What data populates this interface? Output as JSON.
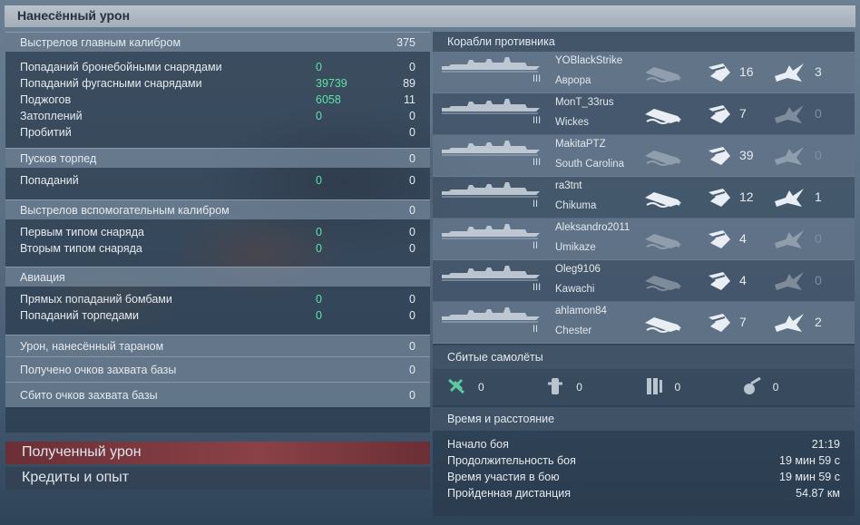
{
  "title": "Нанесённый урон",
  "main_caliber": {
    "label": "Выстрелов главным калибром",
    "value": "375",
    "rows": [
      {
        "label": "Попаданий бронебойными снарядами",
        "damage": "0",
        "count": "0"
      },
      {
        "label": "Попаданий фугасными снарядами",
        "damage": "39739",
        "count": "89"
      },
      {
        "label": "Поджогов",
        "damage": "6058",
        "count": "11"
      },
      {
        "label": "Затоплений",
        "damage": "0",
        "count": "0"
      },
      {
        "label": "Пробитий",
        "damage": "",
        "count": "0"
      }
    ]
  },
  "torpedoes": {
    "label": "Пусков торпед",
    "value": "0",
    "rows": [
      {
        "label": "Попаданий",
        "damage": "0",
        "count": "0"
      }
    ]
  },
  "secondary": {
    "label": "Выстрелов вспомогательным калибром",
    "value": "0",
    "rows": [
      {
        "label": "Первым типом снаряда",
        "damage": "0",
        "count": "0"
      },
      {
        "label": "Вторым типом снаряда",
        "damage": "0",
        "count": "0"
      }
    ]
  },
  "aviation": {
    "label": "Авиация",
    "rows": [
      {
        "label": "Прямых попаданий бомбами",
        "damage": "0",
        "count": "0"
      },
      {
        "label": "Попаданий торпедами",
        "damage": "0",
        "count": "0"
      }
    ]
  },
  "ram": {
    "label": "Урон, нанесённый тараном",
    "value": "0"
  },
  "capture": {
    "label": "Получено очков захвата базы",
    "value": "0"
  },
  "defend": {
    "label": "Сбито очков захвата базы",
    "value": "0"
  },
  "received_label": "Полученный урон",
  "credits_label": "Кредиты и опыт",
  "enemy_header": "Корабли противника",
  "ships": [
    {
      "player": "YOBlackStrike",
      "ship": "Аврора",
      "tier": "III",
      "sunk": false,
      "hits": "16",
      "fires": "3",
      "fires_active": true
    },
    {
      "player": "MonT_33rus",
      "ship": "Wickes",
      "tier": "III",
      "sunk": true,
      "hits": "7",
      "fires": "0",
      "fires_active": false
    },
    {
      "player": "MakitaPTZ",
      "ship": "South Carolina",
      "tier": "III",
      "sunk": false,
      "hits": "39",
      "fires": "0",
      "fires_active": false
    },
    {
      "player": "ra3tnt",
      "ship": "Chikuma",
      "tier": "II",
      "sunk": true,
      "hits": "12",
      "fires": "1",
      "fires_active": true
    },
    {
      "player": "Aleksandro2011",
      "ship": "Umikaze",
      "tier": "II",
      "sunk": false,
      "hits": "4",
      "fires": "0",
      "fires_active": false
    },
    {
      "player": "Oleg9106",
      "ship": "Kawachi",
      "tier": "III",
      "sunk": false,
      "hits": "4",
      "fires": "0",
      "fires_active": false
    },
    {
      "player": "ahlamon84",
      "ship": "Chester",
      "tier": "II",
      "sunk": true,
      "hits": "7",
      "fires": "2",
      "fires_active": true
    }
  ],
  "planes_header": "Сбитые самолёты",
  "planes": [
    {
      "icon": "fighter-icon",
      "value": "0"
    },
    {
      "icon": "torpedo-bomber-icon",
      "value": "0"
    },
    {
      "icon": "dive-bomber-icon",
      "value": "0"
    },
    {
      "icon": "scout-icon",
      "value": "0"
    }
  ],
  "time_header": "Время и расстояние",
  "time_rows": [
    {
      "label": "Начало боя",
      "value": "21:19"
    },
    {
      "label": "Продолжительность боя",
      "value": "19 мин 59 с"
    },
    {
      "label": "Время участия в бою",
      "value": "19 мин 59 с"
    },
    {
      "label": "Пройденная дистанция",
      "value": "54.87 км"
    }
  ],
  "colors": {
    "accent_green": "#5ee0a7",
    "received_bar": "#7a3a3f"
  }
}
